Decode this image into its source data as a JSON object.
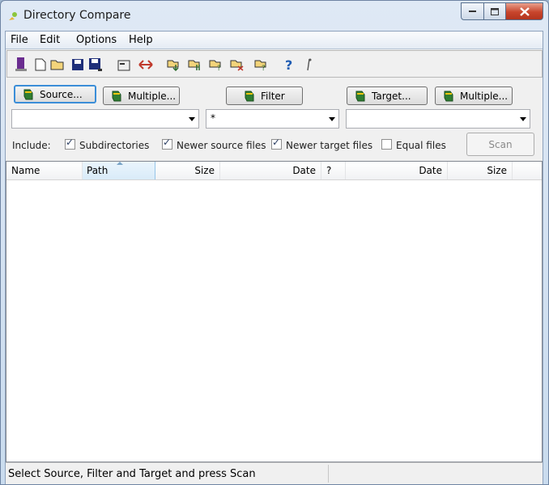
{
  "window": {
    "title": "Directory Compare"
  },
  "menu": [
    "File",
    "Edit",
    "Options",
    "Help"
  ],
  "toolbar_icons": [
    "exit-icon",
    "new-icon",
    "open-folder-icon",
    "save-icon",
    "save-as-icon",
    "properties-icon",
    "swap-icon",
    "copy-to-target-icon",
    "sync-both-icon",
    "compare-unknown-icon",
    "delete-icon",
    "compare-options-icon",
    "help-icon",
    "info-icon"
  ],
  "buttons": {
    "source": "Source...",
    "multiple_source": "Multiple...",
    "filter": "Filter",
    "target": "Target...",
    "multiple_target": "Multiple...",
    "scan": "Scan"
  },
  "combos": {
    "source_value": "",
    "filter_value": "*",
    "target_value": ""
  },
  "include": {
    "label": "Include:",
    "options": [
      {
        "label": "Subdirectories",
        "checked": true
      },
      {
        "label": "Newer source files",
        "checked": true
      },
      {
        "label": "Newer target files",
        "checked": true
      },
      {
        "label": "Equal files",
        "checked": false
      }
    ]
  },
  "columns": [
    "Name",
    "Path",
    "Size",
    "Date",
    "?",
    "Date",
    "Size"
  ],
  "status": "Select Source, Filter and Target and press Scan"
}
